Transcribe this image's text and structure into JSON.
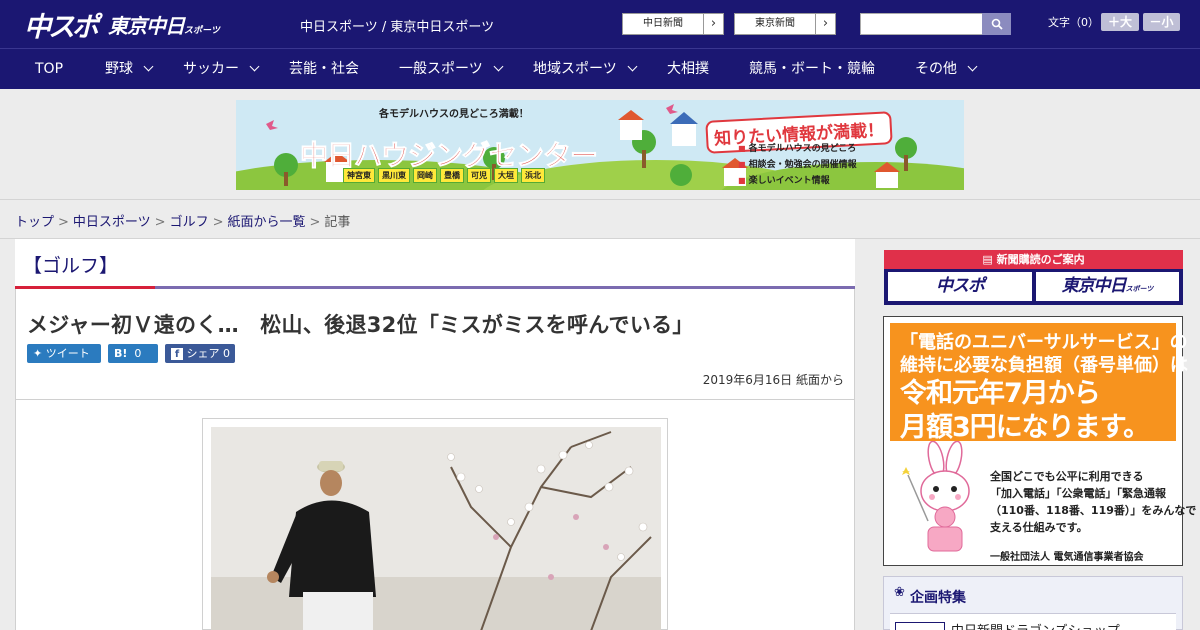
{
  "header": {
    "logo_main": "中スポ",
    "logo_tokyo": "東京中日",
    "logo_tokyo_small": "スポーツ",
    "site_links": "中日スポーツ / 東京中日スポーツ",
    "paper_buttons": [
      "中日新聞",
      "東京新聞"
    ],
    "search_placeholder": "",
    "font_size_label": "文字（0）",
    "font_larger": "＋大",
    "font_smaller": "－小"
  },
  "nav": {
    "items": [
      {
        "label": "TOP",
        "dropdown": false
      },
      {
        "label": "野球",
        "dropdown": true
      },
      {
        "label": "サッカー",
        "dropdown": true
      },
      {
        "label": "芸能・社会",
        "dropdown": false
      },
      {
        "label": "一般スポーツ",
        "dropdown": true
      },
      {
        "label": "地域スポーツ",
        "dropdown": true
      },
      {
        "label": "大相撲",
        "dropdown": false
      },
      {
        "label": "競馬・ボート・競輪",
        "dropdown": false
      },
      {
        "label": "その他",
        "dropdown": true
      }
    ]
  },
  "banner": {
    "sub": "各モデルハウスの見どころ満載！",
    "title": "中日ハウジングセンター",
    "headline": "知りたい情報が満載！",
    "towns": [
      "神宮東",
      "黒川東",
      "岡崎",
      "豊橋",
      "可児",
      "大垣",
      "浜北"
    ],
    "bullets": [
      "各モデルハウスの見どころ",
      "相談会・勉強会の開催情報",
      "楽しいイベント情報"
    ]
  },
  "breadcrumb": {
    "items": [
      "トップ",
      "中日スポーツ",
      "ゴルフ",
      "紙面から一覧"
    ],
    "current": "記事"
  },
  "article": {
    "category": "【ゴルフ】",
    "headline": "メジャー初Ｖ遠のく…　松山、後退32位「ミスがミスを呼んでいる」",
    "tweet_label": "ツイート",
    "hatena_label": "B!",
    "hatena_count": "0",
    "fb_label": "シェア",
    "fb_count": "0",
    "dateline": "2019年6月16日 紙面から"
  },
  "sidebar": {
    "subscribe_head": "新聞購読のご案内",
    "subscribe_logo1": "中スポ",
    "subscribe_logo2": "東京中日",
    "subscribe_logo2_small": "スポーツ",
    "ad_quote_line1": "「電話のユニバーサルサービス」の",
    "ad_quote_line2": "維持に必要な負担額（番号単価）は",
    "ad_big_line1": "令和元年7月から",
    "ad_big_line2": "月額3円になります。",
    "ad_text": [
      "全国どこでも公平に利用できる",
      "「加入電話」「公衆電話」「緊急通報",
      "（110番、118番、119番）」をみんなで",
      "支える仕組みです。"
    ],
    "ad_org": "一般社団法人 電気通信事業者協会",
    "feature_title": "企画特集",
    "feature_item": "中日新聞ドラゴンズショップ"
  },
  "colors": {
    "brand_navy": "#1b1772",
    "accent_red": "#d6203a",
    "ad_orange": "#f7931e"
  }
}
